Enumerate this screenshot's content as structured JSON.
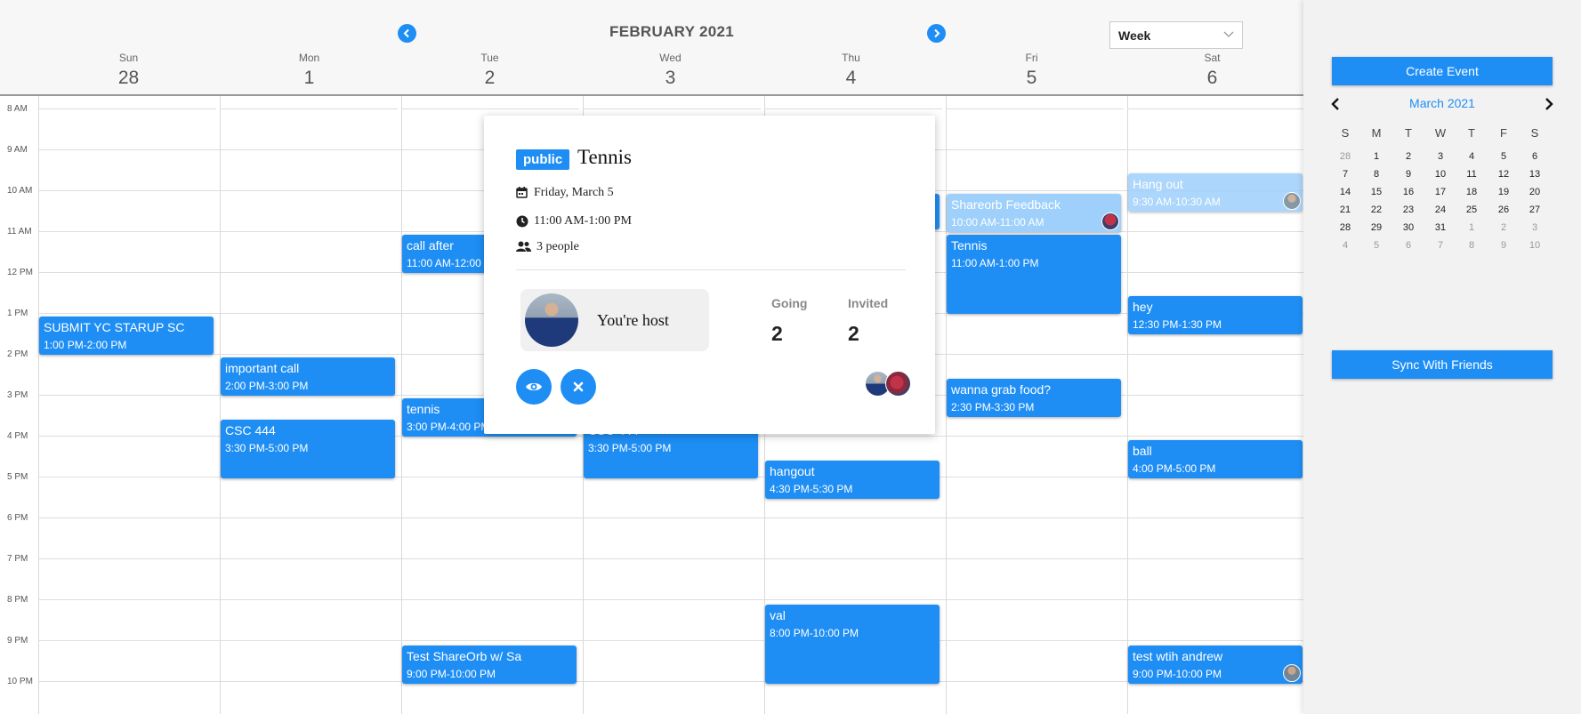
{
  "header": {
    "month_title": "FEBRUARY 2021",
    "view_selected": "Week",
    "days": [
      {
        "name": "Sun",
        "num": "28"
      },
      {
        "name": "Mon",
        "num": "1"
      },
      {
        "name": "Tue",
        "num": "2"
      },
      {
        "name": "Wed",
        "num": "3"
      },
      {
        "name": "Thu",
        "num": "4"
      },
      {
        "name": "Fri",
        "num": "5"
      },
      {
        "name": "Sat",
        "num": "6"
      }
    ]
  },
  "hours": [
    "8 AM",
    "9 AM",
    "10 AM",
    "11 AM",
    "12 PM",
    "1 PM",
    "2 PM",
    "3 PM",
    "4 PM",
    "5 PM",
    "6 PM",
    "7 PM",
    "8 PM",
    "9 PM",
    "10 PM"
  ],
  "events": {
    "sun_submit": {
      "title": "SUBMIT YC STARUP SC",
      "time": "1:00 PM-2:00 PM"
    },
    "mon_call": {
      "title": "important call",
      "time": "2:00 PM-3:00 PM"
    },
    "mon_csc": {
      "title": "CSC 444",
      "time": "3:30 PM-5:00 PM"
    },
    "tue_call_after": {
      "title": "call after",
      "time": "11:00 AM-12:00"
    },
    "tue_tennis": {
      "title": "tennis",
      "time": "3:00 PM-4:00 PM"
    },
    "tue_shareorb": {
      "title": "Test ShareOrb w/ Sa",
      "time": "9:00 PM-10:00 PM"
    },
    "wed_csc": {
      "title": "CSC 444",
      "time": "3:30 PM-5:00 PM"
    },
    "thu_hangout": {
      "title": "hangout",
      "time": "4:30 PM-5:30 PM"
    },
    "thu_val": {
      "title": "val",
      "time": "8:00 PM-10:00 PM"
    },
    "fri_feedback": {
      "title": "Shareorb Feedback",
      "time": "10:00 AM-11:00 AM"
    },
    "fri_tennis": {
      "title": "Tennis",
      "time": "11:00 AM-1:00 PM"
    },
    "fri_food": {
      "title": "wanna grab food?",
      "time": "2:30 PM-3:30 PM"
    },
    "sat_hang": {
      "title": "Hang out",
      "time": "9:30 AM-10:30 AM"
    },
    "sat_hey": {
      "title": "hey",
      "time": "12:30 PM-1:30 PM"
    },
    "sat_ball": {
      "title": "ball",
      "time": "4:00 PM-5:00 PM"
    },
    "sat_andrew": {
      "title": "test wtih andrew",
      "time": "9:00 PM-10:00 PM"
    }
  },
  "popup": {
    "badge": "public",
    "title": "Tennis",
    "date": "Friday, March 5",
    "time": "11:00 AM-1:00 PM",
    "people": "3 people",
    "host_label": "You're host",
    "going_label": "Going",
    "going_count": "2",
    "invited_label": "Invited",
    "invited_count": "2",
    "icons": [
      "calendar-icon",
      "clock-icon",
      "people-icon",
      "eye-icon",
      "close-icon"
    ]
  },
  "sidebar": {
    "create_label": "Create Event",
    "sync_label": "Sync With Friends",
    "mini_title": "March 2021",
    "weekday_headers": [
      "S",
      "M",
      "T",
      "W",
      "T",
      "F",
      "S"
    ],
    "weeks": [
      [
        "28",
        "1",
        "2",
        "3",
        "4",
        "5",
        "6"
      ],
      [
        "7",
        "8",
        "9",
        "10",
        "11",
        "12",
        "13"
      ],
      [
        "14",
        "15",
        "16",
        "17",
        "18",
        "19",
        "20"
      ],
      [
        "21",
        "22",
        "23",
        "24",
        "25",
        "26",
        "27"
      ],
      [
        "28",
        "29",
        "30",
        "31",
        "1",
        "2",
        "3"
      ],
      [
        "4",
        "5",
        "6",
        "7",
        "8",
        "9",
        "10"
      ]
    ]
  },
  "colors": {
    "accent": "#1e8ef5",
    "faded_event": "#9ed0fb",
    "sidebar_bg": "#f2f2f2"
  }
}
